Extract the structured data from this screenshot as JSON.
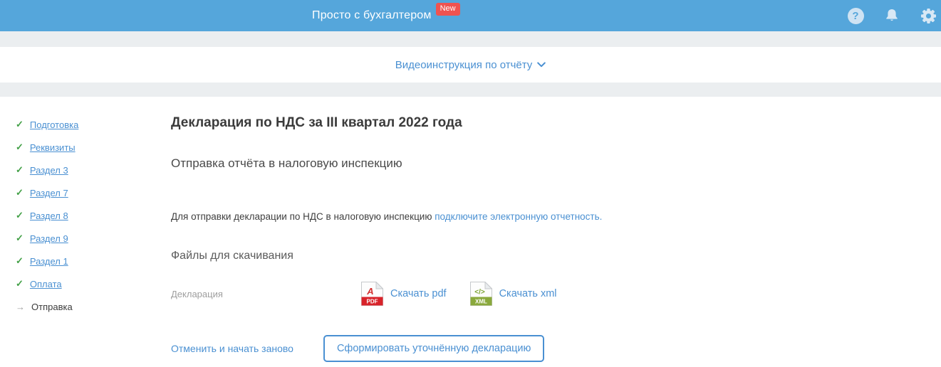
{
  "header": {
    "title": "Просто с бухгалтером",
    "badge": "New",
    "help_icon": "?",
    "icons": [
      "help-icon",
      "bell-icon",
      "gear-icon"
    ]
  },
  "video_band": {
    "link_label": "Видеоинструкция по отчёту"
  },
  "sidebar": {
    "check_glyph": "✓",
    "arrow_glyph": "→",
    "items": [
      {
        "label": "Подготовка",
        "state": "done"
      },
      {
        "label": "Реквизиты",
        "state": "done"
      },
      {
        "label": "Раздел 3",
        "state": "done"
      },
      {
        "label": "Раздел 7",
        "state": "done"
      },
      {
        "label": "Раздел 8",
        "state": "done"
      },
      {
        "label": "Раздел 9",
        "state": "done"
      },
      {
        "label": "Раздел 1",
        "state": "done"
      },
      {
        "label": "Оплата",
        "state": "done"
      },
      {
        "label": "Отправка",
        "state": "current"
      }
    ]
  },
  "main": {
    "title": "Декларация по НДС за III квартал 2022 года",
    "subtitle": "Отправка отчёта в налоговую инспекцию",
    "info_text": "Для отправки декларации по НДС в налоговую инспекцию ",
    "info_link": "подключите электронную отчетность.",
    "files_header": "Файлы для скачивания",
    "file_row": {
      "label": "Декларация",
      "pdf_badge": "PDF",
      "pdf_symbol": "A",
      "pdf_link": "Скачать pdf",
      "xml_badge": "XML",
      "xml_symbol": "</>",
      "xml_link": "Скачать xml"
    },
    "footer": {
      "cancel_link": "Отменить и начать заново",
      "button_label": "Сформировать уточнённую декларацию"
    }
  },
  "colors": {
    "header_bg": "#55a6db",
    "badge_red": "#ef5350",
    "strip_gray": "#ebeef0",
    "link_blue": "#4a90d2",
    "check_green": "#43a047",
    "pdf_red": "#d8232a",
    "xml_green": "#8aa93c"
  }
}
